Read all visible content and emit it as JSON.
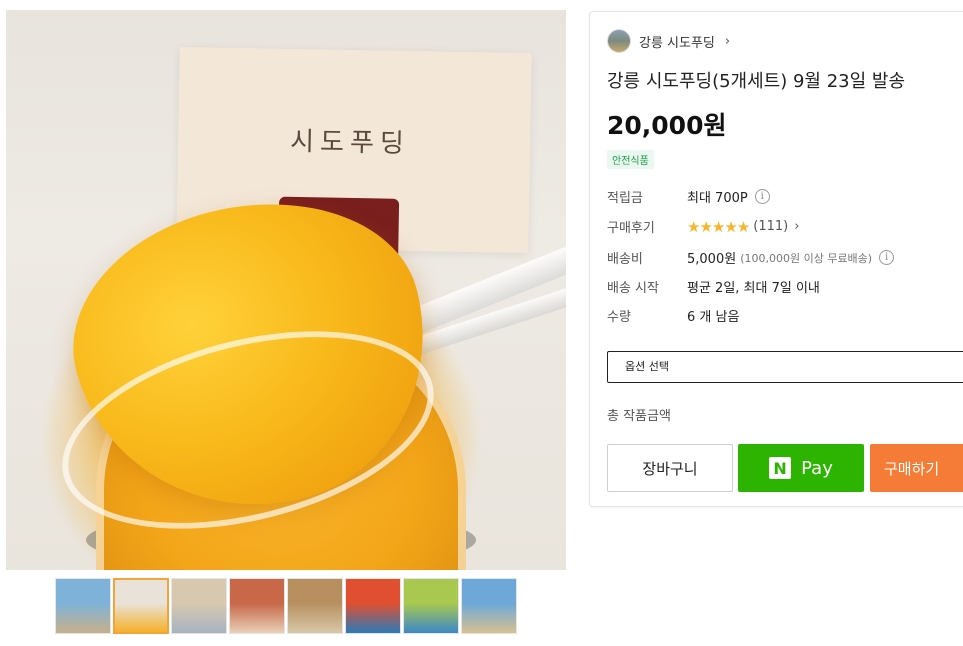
{
  "seller": {
    "name": "강릉 시도푸딩",
    "chevron": "›"
  },
  "product": {
    "title": "강릉 시도푸딩(5개세트) 9월 23일 발송",
    "price": "20,000원",
    "badge": "안전식품",
    "image_card_title": "시도푸딩",
    "rating_stars": 5
  },
  "info": {
    "points_label": "적립금",
    "points_value": "최대 700P",
    "review_label": "구매후기",
    "stars_glyph": "★★★★★",
    "review_count": "(111)",
    "review_chevron": "›",
    "shipping_label": "배송비",
    "shipping_value": "5,000원",
    "shipping_sub": "(100,000원 이상 무료배송)",
    "ship_start_label": "배송 시작",
    "ship_start_value": "평균 2일, 최대 7일 이내",
    "qty_label": "수량",
    "qty_value": "6 개 남음",
    "info_glyph": "i"
  },
  "option": {
    "placeholder": "옵션 선택"
  },
  "total": {
    "label": "총 작품금액"
  },
  "buttons": {
    "cart": "장바구니",
    "npay_logo": "N",
    "npay": "Pay",
    "buy": "구매하기"
  },
  "thumbnails": [
    {
      "label": "beach-with-jars",
      "colors": [
        "#c8b08a",
        "#7fb2d8"
      ]
    },
    {
      "label": "spoon-pudding",
      "colors": [
        "#f5b12a",
        "#e8e2d8"
      ],
      "active": true
    },
    {
      "label": "box-on-rocks",
      "colors": [
        "#a6b4c0",
        "#d8c8b0"
      ]
    },
    {
      "label": "jar-with-label",
      "colors": [
        "#e8d0b8",
        "#c86848"
      ]
    },
    {
      "label": "pudding-closeup",
      "colors": [
        "#d8c8a8",
        "#b89060"
      ]
    },
    {
      "label": "hand-with-jar-sea",
      "colors": [
        "#2a7ab8",
        "#e05030"
      ]
    },
    {
      "label": "hand-green-jar-sea",
      "colors": [
        "#3a88c8",
        "#a8c850"
      ]
    },
    {
      "label": "jar-on-sand",
      "colors": [
        "#d8c090",
        "#6ea8d8"
      ]
    }
  ],
  "colors": {
    "npay_green": "#2db400",
    "buy_orange": "#f47c36",
    "badge_green": "#1a9e4b",
    "star_yellow": "#f7b52c",
    "active_thumb_border": "#f4a23a"
  }
}
